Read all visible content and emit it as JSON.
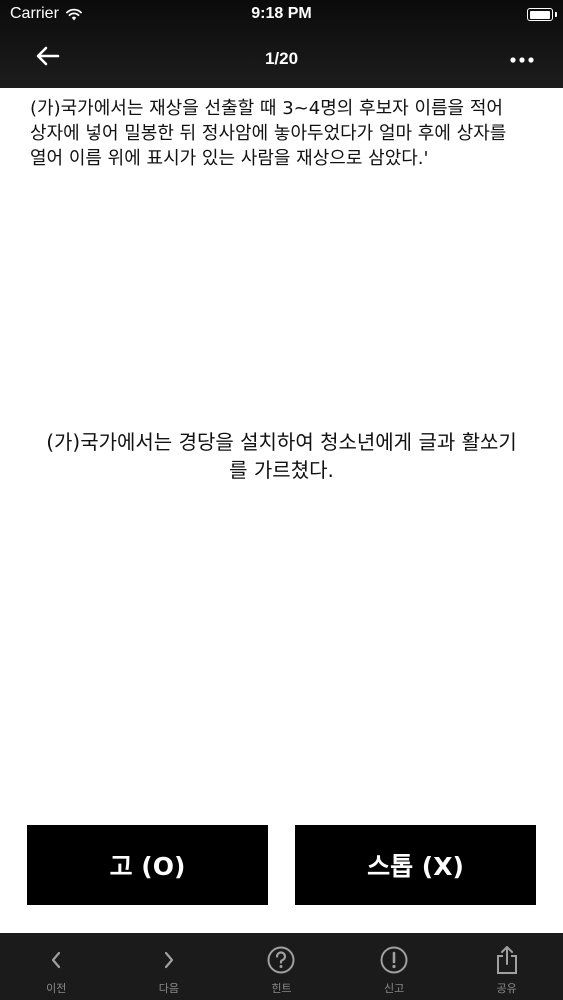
{
  "status_bar": {
    "carrier": "Carrier",
    "time": "9:18 PM",
    "battery_level": 1.0
  },
  "nav": {
    "title": "1/20",
    "back_icon": "arrow-left-icon",
    "more_icon": "ellipsis-icon"
  },
  "content": {
    "question": "(가)국가에서는 재상을 선출할 때 3~4명의 후보자 이름을 적어\n상자에 넣어 밀봉한 뒤 정사암에 놓아두었다가 얼마 후에 상자를\n열어 이름 위에 표시가 있는 사람을 재상으로 삼았다.'",
    "statement": "(가)국가에서는 경당을 설치하여 청소년에게 글과 활쏘기\n를 가르쳤다."
  },
  "answers": {
    "go_label": "고 (O)",
    "stop_label": "스톱 (X)"
  },
  "tabs": [
    {
      "label": "이전",
      "icon": "chevron-left-icon"
    },
    {
      "label": "다음",
      "icon": "chevron-right-icon"
    },
    {
      "label": "힌트",
      "icon": "question-circle-icon"
    },
    {
      "label": "신고",
      "icon": "exclamation-circle-icon"
    },
    {
      "label": "공유",
      "icon": "share-icon"
    }
  ],
  "colors": {
    "header_bg": "#141414",
    "tab_bar_bg": "#1b1b1b",
    "button_bg": "#000000",
    "tab_icon": "#a0a0a0",
    "tab_label": "#8a8a8a"
  }
}
